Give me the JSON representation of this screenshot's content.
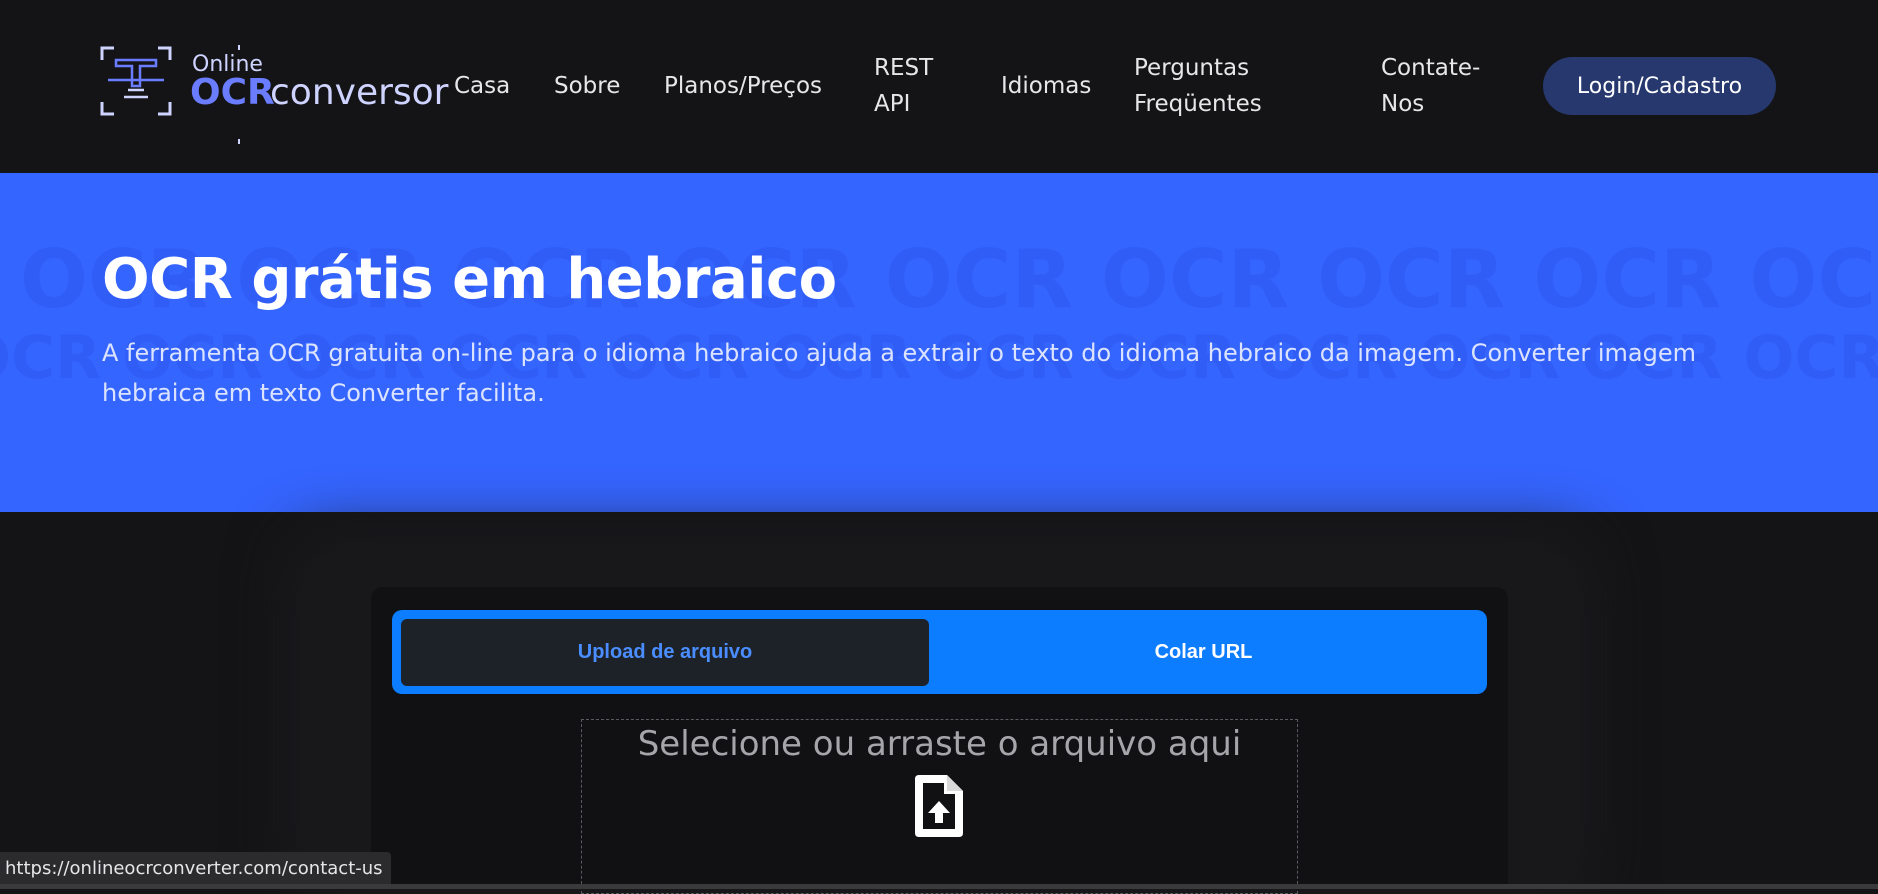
{
  "header": {
    "logo": {
      "online": "Online",
      "ocr": "OCR",
      "conversor": "conversor"
    },
    "nav": [
      {
        "label": "Casa"
      },
      {
        "label": "Sobre"
      },
      {
        "label": "Planos/Preços"
      },
      {
        "label_line1": "REST",
        "label_line2": "API"
      },
      {
        "label": "Idiomas"
      },
      {
        "label_line1": "Perguntas",
        "label_line2": "Freqüentes"
      },
      {
        "label_line1": "Contate-",
        "label_line2": "Nos"
      }
    ],
    "login_label": "Login/Cadastro"
  },
  "hero": {
    "title": "OCR grátis em hebraico",
    "description": "A ferramenta OCR gratuita on-line para o idioma hebraico ajuda a extrair o texto do idioma hebraico da imagem. Converter imagem hebraica em texto Converter facilita."
  },
  "upload": {
    "tabs": [
      {
        "label": "Upload de arquivo",
        "active": true
      },
      {
        "label": "Colar URL",
        "active": false
      }
    ],
    "dropzone_text": "Selecione ou arraste o arquivo aqui",
    "dropzone_icon": "file-upload-icon"
  },
  "status_bar": {
    "url": "https://onlineocrconverter.com/contact-us"
  },
  "colors": {
    "hero_bg": "#3565ff",
    "tab_bar": "#0c7dff",
    "login_bg": "#26386e",
    "page_bg": "#141416"
  }
}
